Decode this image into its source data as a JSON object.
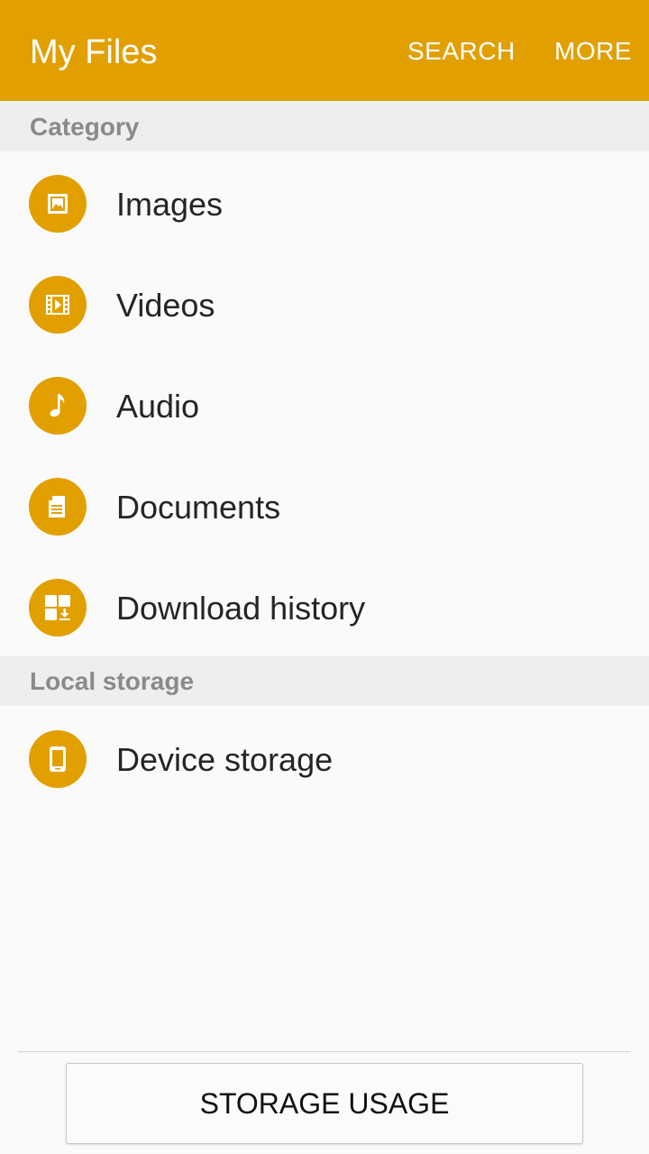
{
  "appbar": {
    "title": "My Files",
    "search_label": "SEARCH",
    "more_label": "MORE",
    "accent_color": "#e1a000"
  },
  "sections": {
    "category": "Category",
    "local_storage": "Local storage"
  },
  "category_items": [
    {
      "label": "Images",
      "icon": "image-icon"
    },
    {
      "label": "Videos",
      "icon": "video-icon"
    },
    {
      "label": "Audio",
      "icon": "music-note-icon"
    },
    {
      "label": "Documents",
      "icon": "document-icon"
    },
    {
      "label": "Download history",
      "icon": "download-icon"
    }
  ],
  "storage_items": [
    {
      "label": "Device storage",
      "icon": "phone-icon"
    }
  ],
  "footer": {
    "storage_usage_label": "STORAGE USAGE"
  }
}
